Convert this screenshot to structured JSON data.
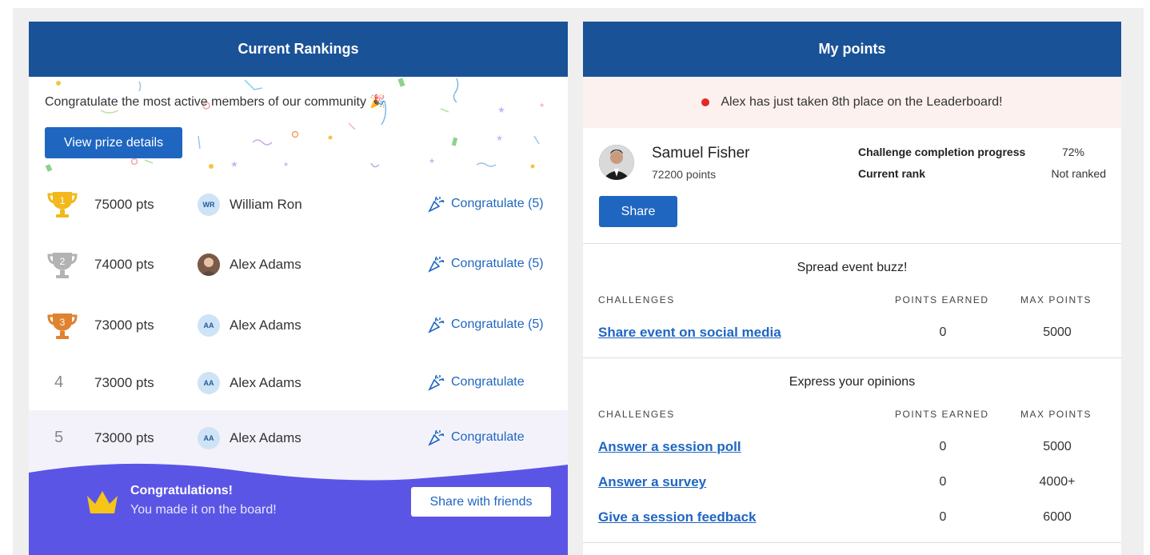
{
  "rankings": {
    "title": "Current Rankings",
    "intro": "Congratulate the most active members of our community",
    "intro_emoji": "🎉",
    "prize_button": "View prize details",
    "rows": [
      {
        "rank": "1",
        "points": "75000 pts",
        "initials": "WR",
        "name": "William Ron",
        "congrats": "Congratulate (5)",
        "trophy": "gold-trophy-icon"
      },
      {
        "rank": "2",
        "points": "74000 pts",
        "initials": "",
        "name": "Alex Adams",
        "congrats": "Congratulate (5)",
        "trophy": "silver-trophy-icon"
      },
      {
        "rank": "3",
        "points": "73000 pts",
        "initials": "AA",
        "name": "Alex Adams",
        "congrats": "Congratulate (5)",
        "trophy": "bronze-trophy-icon"
      },
      {
        "rank": "4",
        "points": "73000 pts",
        "initials": "AA",
        "name": "Alex Adams",
        "congrats": "Congratulate"
      },
      {
        "rank": "5",
        "points": "73000 pts",
        "initials": "AA",
        "name": "Alex Adams",
        "congrats": "Congratulate"
      }
    ],
    "banner": {
      "title": "Congratulations!",
      "subtitle": "You made it on the board!",
      "share_button": "Share with friends"
    }
  },
  "my_points": {
    "title": "My points",
    "notice": "Alex has just taken 8th place on the Leaderboard!",
    "profile": {
      "name": "Samuel Fisher",
      "points": "72200 points",
      "progress_label": "Challenge completion progress",
      "progress_value": "72%",
      "rank_label": "Current rank",
      "rank_value": "Not ranked",
      "share_button": "Share"
    },
    "sections": [
      {
        "title": "Spread event buzz!",
        "headers": {
          "challenges": "CHALLENGES",
          "earned": "POINTS EARNED",
          "max": "MAX POINTS"
        },
        "items": [
          {
            "name": "Share event on social media",
            "earned": "0",
            "max": "5000"
          }
        ]
      },
      {
        "title": "Express your opinions",
        "headers": {
          "challenges": "CHALLENGES",
          "earned": "POINTS EARNED",
          "max": "MAX POINTS"
        },
        "items": [
          {
            "name": "Answer a session poll",
            "earned": "0",
            "max": "5000"
          },
          {
            "name": "Answer a survey",
            "earned": "0",
            "max": "4000+"
          },
          {
            "name": "Give a session feedback",
            "earned": "0",
            "max": "6000"
          }
        ]
      }
    ]
  },
  "colors": {
    "header": "#1a5297",
    "button": "#1f66c1",
    "banner": "#5b55e6",
    "gold": "#f2b81c",
    "silver": "#b3b3b3",
    "bronze": "#e0822e",
    "notice_bg": "#fcf1ee"
  }
}
